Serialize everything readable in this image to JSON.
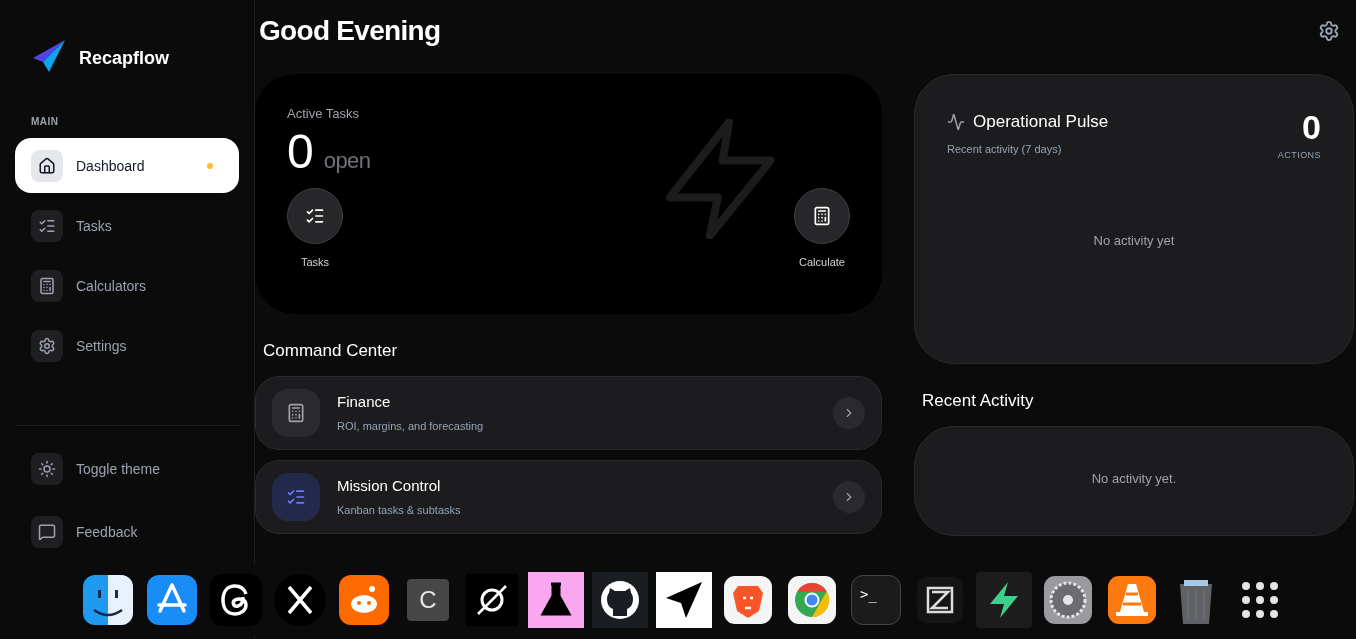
{
  "brand": {
    "name": "Recapflow"
  },
  "sidebar": {
    "section": "MAIN",
    "items": [
      {
        "label": "Dashboard",
        "kind": "home",
        "selected": true,
        "dot": true
      },
      {
        "label": "Tasks",
        "kind": "tasks",
        "selected": false,
        "dot": false
      },
      {
        "label": "Calculators",
        "kind": "calc",
        "selected": false,
        "dot": false
      },
      {
        "label": "Settings",
        "kind": "gear",
        "selected": false,
        "dot": false
      }
    ],
    "footer": [
      {
        "label": "Toggle theme",
        "kind": "sun"
      },
      {
        "label": "Feedback",
        "kind": "chat"
      }
    ]
  },
  "greeting": "Good Evening",
  "hero": {
    "label": "Active Tasks",
    "count": "0",
    "unit": "open",
    "actions": [
      {
        "label": "Tasks",
        "kind": "tasks"
      },
      {
        "label": "Calculate",
        "kind": "calc"
      }
    ]
  },
  "command_center": {
    "title": "Command Center",
    "cards": [
      {
        "title": "Finance",
        "subtitle": "ROI, margins, and forecasting",
        "kind": "calc"
      },
      {
        "title": "Mission Control",
        "subtitle": "Kanban tasks & subtasks",
        "kind": "tasks"
      }
    ]
  },
  "pulse": {
    "title": "Operational Pulse",
    "subtitle": "Recent activity (7 days)",
    "count": "0",
    "count_label": "ACTIONS",
    "empty": "No activity yet"
  },
  "recent": {
    "title": "Recent Activity",
    "empty": "No activity yet."
  },
  "dock": [
    {
      "kind": "finder"
    },
    {
      "kind": "store"
    },
    {
      "kind": "threads"
    },
    {
      "kind": "x"
    },
    {
      "kind": "reddit"
    },
    {
      "kind": "letter",
      "text": "C"
    },
    {
      "kind": "orbit"
    },
    {
      "kind": "flask"
    },
    {
      "kind": "github"
    },
    {
      "kind": "plane"
    },
    {
      "kind": "lion"
    },
    {
      "kind": "chrome"
    },
    {
      "kind": "terminal",
      "text": ">_"
    },
    {
      "kind": "zed"
    },
    {
      "kind": "bolt"
    },
    {
      "kind": "gear"
    },
    {
      "kind": "cone"
    },
    {
      "kind": "trash"
    },
    {
      "kind": "grid"
    }
  ]
}
